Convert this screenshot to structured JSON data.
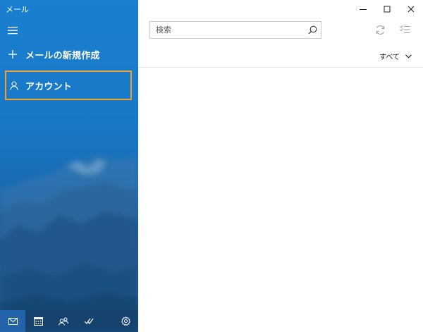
{
  "window": {
    "title": "メール"
  },
  "nav": {
    "new_mail_label": "メールの新規作成",
    "account_label": "アカウント"
  },
  "search": {
    "placeholder": "検索"
  },
  "filter": {
    "label": "すべて"
  },
  "bottom_bar": {
    "items": [
      "mail-icon",
      "calendar-icon",
      "people-icon",
      "todo-icon",
      "settings-icon"
    ],
    "active": "mail-icon"
  },
  "colors": {
    "nav_blue": "#1a7fd0",
    "highlight_border": "#f0a030",
    "divider": "#e6e6e6"
  }
}
